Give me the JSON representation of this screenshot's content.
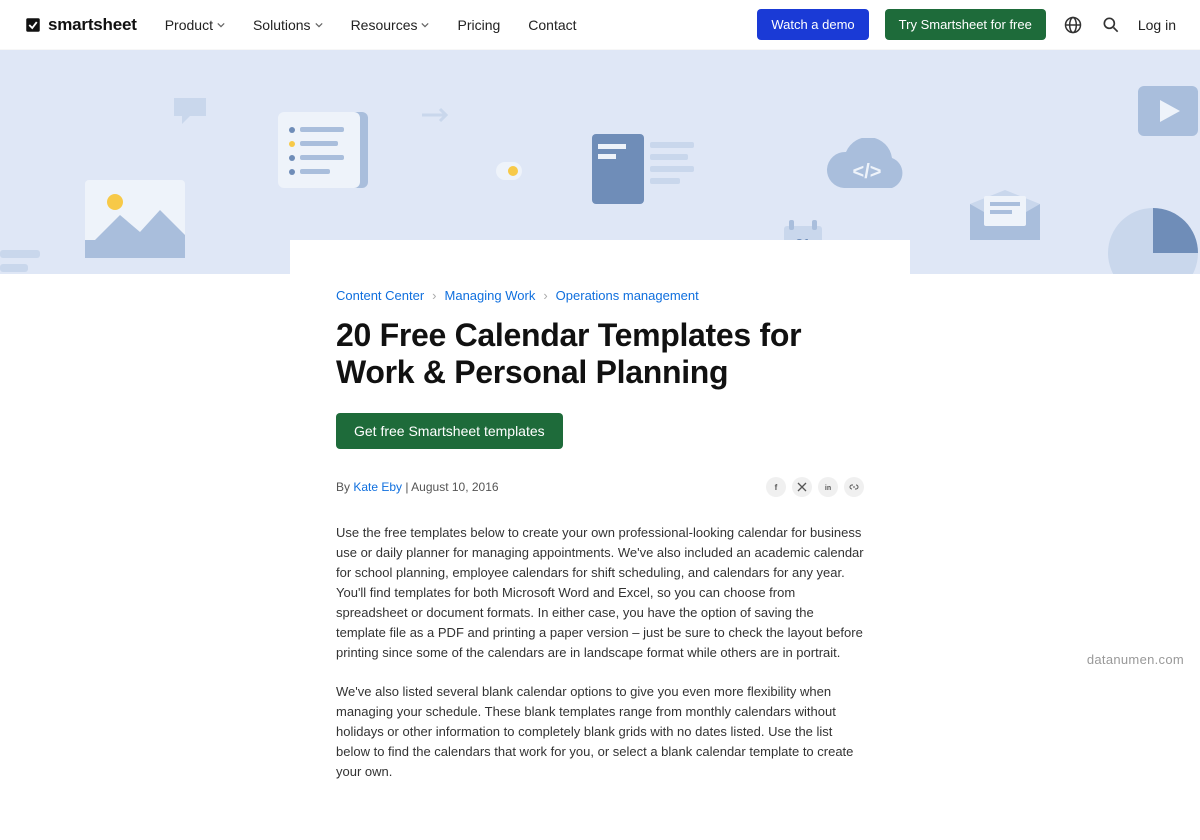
{
  "nav": {
    "brand": "smartsheet",
    "items": [
      {
        "label": "Product",
        "dropdown": true
      },
      {
        "label": "Solutions",
        "dropdown": true
      },
      {
        "label": "Resources",
        "dropdown": true
      },
      {
        "label": "Pricing",
        "dropdown": false
      },
      {
        "label": "Contact",
        "dropdown": false
      }
    ],
    "demo_btn": "Watch a demo",
    "try_btn": "Try Smartsheet for free",
    "login": "Log in"
  },
  "breadcrumbs": [
    "Content Center",
    "Managing Work",
    "Operations management"
  ],
  "article": {
    "title": "20 Free Calendar Templates for Work & Personal Planning",
    "cta": "Get free Smartsheet templates",
    "byline_prefix": "By ",
    "author": "Kate Eby",
    "byline_sep": " | ",
    "date": "August 10, 2016",
    "p1": "Use the free templates below to create your own professional-looking calendar for business use or daily planner for managing appointments. We've also included an academic calendar for school planning, employee calendars for shift scheduling, and calendars for any year. You'll find templates for both Microsoft Word and Excel, so you can choose from spreadsheet or document formats. In either case, you have the option of saving the template file as a PDF and printing a paper version – just be sure to check the layout before printing since some of the calendars are in landscape format while others are in portrait.",
    "p2": "We've also listed several blank calendar options to give you even more flexibility when managing your schedule. These blank templates range from monthly calendars without holidays or other information to completely blank grids with no dates listed. Use the list below to find the calendars that work for you, or select a blank calendar template to create your own."
  },
  "watermark": "datanumen.com"
}
